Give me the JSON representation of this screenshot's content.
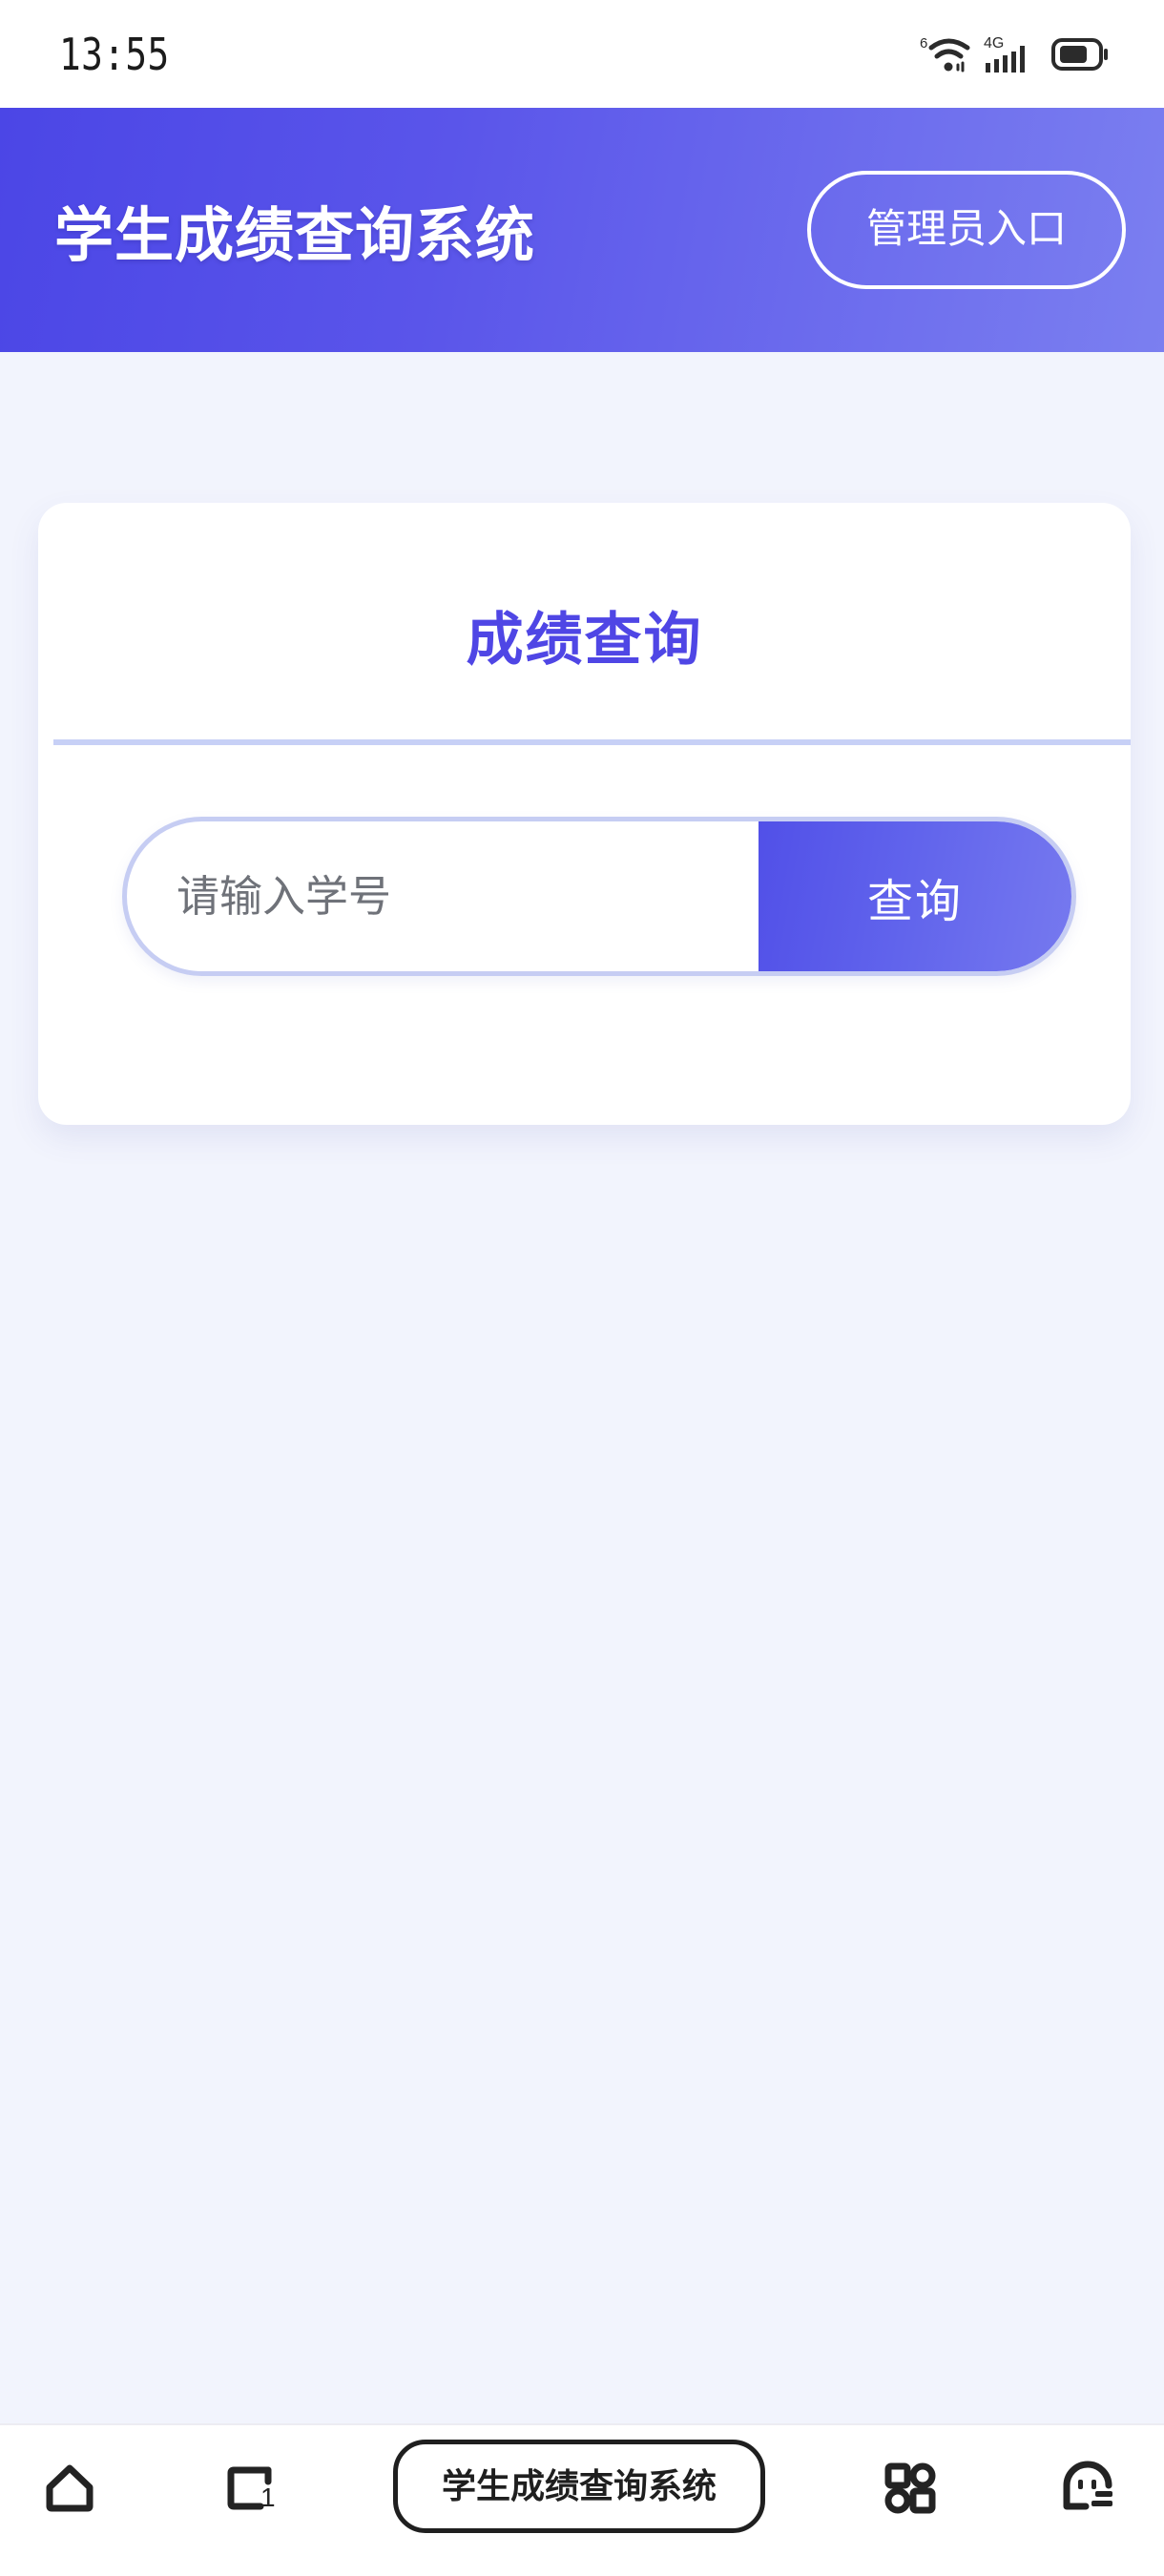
{
  "status_bar": {
    "time": "13:55",
    "icons": [
      "wifi-6-icon",
      "signal-4g-icon",
      "battery-icon"
    ]
  },
  "header": {
    "title": "学生成绩查询系统",
    "admin_button": "管理员入口",
    "gradient_from": "#4B46E6",
    "gradient_to": "#7B7FF0"
  },
  "card": {
    "title": "成绩查询",
    "title_color": "#4F46E5",
    "divider_color": "#C7D0F6"
  },
  "search": {
    "placeholder": "请输入学号",
    "value": "",
    "button_label": "查询",
    "button_gradient_from": "#5150E8",
    "button_gradient_to": "#7679EF",
    "border_color": "#C6CDF3"
  },
  "nav_bar": {
    "home_icon": "home-icon",
    "tabs_icon": "tab-switcher-icon",
    "tabs_count": "1",
    "app_pill_label": "学生成绩查询系统",
    "apps_icon": "apps-grid-icon",
    "assistant_icon": "assistant-face-icon"
  },
  "page": {
    "background": "#F2F4FD"
  }
}
